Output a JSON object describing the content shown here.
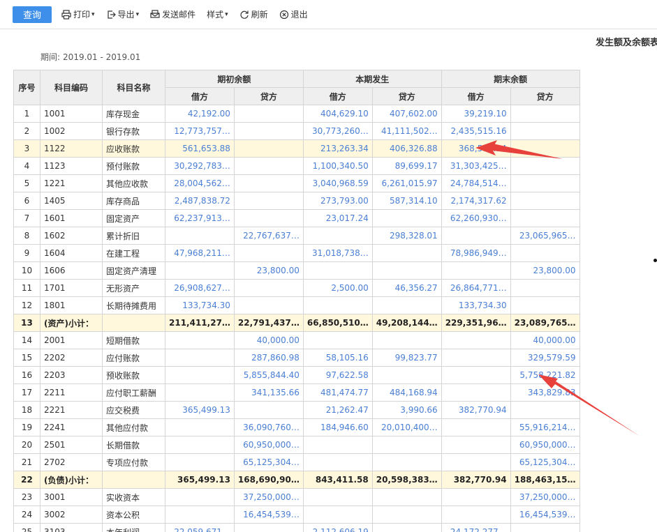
{
  "toolbar": {
    "query": "查询",
    "print": "打印",
    "export": "导出",
    "email": "发送邮件",
    "style": "样式",
    "refresh": "刷新",
    "exit": "退出"
  },
  "report": {
    "title": "发生额及余额表",
    "period_label": "期间:",
    "period_value": "2019.01 - 2019.01"
  },
  "table": {
    "headers": {
      "idx": "序号",
      "code": "科目编码",
      "name": "科目名称",
      "opening": "期初余额",
      "current": "本期发生",
      "closing": "期末余额",
      "debit": "借方",
      "credit": "贷方"
    },
    "rows": [
      {
        "idx": "1",
        "code": "1001",
        "name": "库存现金",
        "od": "42,192.00",
        "oc": "",
        "cd": "404,629.10",
        "cc": "407,602.00",
        "ed": "39,219.10",
        "ec": "",
        "type": ""
      },
      {
        "idx": "2",
        "code": "1002",
        "name": "银行存款",
        "od": "12,773,757…",
        "oc": "",
        "cd": "30,773,260…",
        "cc": "41,111,502…",
        "ed": "2,435,515.16",
        "ec": "",
        "type": ""
      },
      {
        "idx": "3",
        "code": "1122",
        "name": "应收账款",
        "od": "561,653.88",
        "oc": "",
        "cd": "213,263.34",
        "cc": "406,326.88",
        "ed": "368,590.34",
        "ec": "",
        "type": "hl"
      },
      {
        "idx": "4",
        "code": "1123",
        "name": "预付账款",
        "od": "30,292,783…",
        "oc": "",
        "cd": "1,100,340.50",
        "cc": "89,699.17",
        "ed": "31,303,425…",
        "ec": "",
        "type": ""
      },
      {
        "idx": "5",
        "code": "1221",
        "name": "其他应收款",
        "od": "28,004,562…",
        "oc": "",
        "cd": "3,040,968.59",
        "cc": "6,261,015.97",
        "ed": "24,784,514…",
        "ec": "",
        "type": ""
      },
      {
        "idx": "6",
        "code": "1405",
        "name": "库存商品",
        "od": "2,487,838.72",
        "oc": "",
        "cd": "273,793.00",
        "cc": "587,314.10",
        "ed": "2,174,317.62",
        "ec": "",
        "type": ""
      },
      {
        "idx": "7",
        "code": "1601",
        "name": "固定资产",
        "od": "62,237,913…",
        "oc": "",
        "cd": "23,017.24",
        "cc": "",
        "ed": "62,260,930…",
        "ec": "",
        "type": ""
      },
      {
        "idx": "8",
        "code": "1602",
        "name": "累计折旧",
        "od": "",
        "oc": "22,767,637…",
        "cd": "",
        "cc": "298,328.01",
        "ed": "",
        "ec": "23,065,965…",
        "type": ""
      },
      {
        "idx": "9",
        "code": "1604",
        "name": "在建工程",
        "od": "47,968,211…",
        "oc": "",
        "cd": "31,018,738…",
        "cc": "",
        "ed": "78,986,949…",
        "ec": "",
        "type": ""
      },
      {
        "idx": "10",
        "code": "1606",
        "name": "固定资产清理",
        "od": "",
        "oc": "23,800.00",
        "cd": "",
        "cc": "",
        "ed": "",
        "ec": "23,800.00",
        "type": ""
      },
      {
        "idx": "11",
        "code": "1701",
        "name": "无形资产",
        "od": "26,908,627…",
        "oc": "",
        "cd": "2,500.00",
        "cc": "46,356.27",
        "ed": "26,864,771…",
        "ec": "",
        "type": ""
      },
      {
        "idx": "12",
        "code": "1801",
        "name": "长期待摊费用",
        "od": "133,734.30",
        "oc": "",
        "cd": "",
        "cc": "",
        "ed": "133,734.30",
        "ec": "",
        "type": ""
      },
      {
        "idx": "13",
        "code": "(资产)小计：",
        "name": "",
        "od": "211,411,27…",
        "oc": "22,791,437…",
        "cd": "66,850,510…",
        "cc": "49,208,144…",
        "ed": "229,351,96…",
        "ec": "23,089,765…",
        "type": "sub"
      },
      {
        "idx": "14",
        "code": "2001",
        "name": "短期借款",
        "od": "",
        "oc": "40,000.00",
        "cd": "",
        "cc": "",
        "ed": "",
        "ec": "40,000.00",
        "type": ""
      },
      {
        "idx": "15",
        "code": "2202",
        "name": "应付账款",
        "od": "",
        "oc": "287,860.98",
        "cd": "58,105.16",
        "cc": "99,823.77",
        "ed": "",
        "ec": "329,579.59",
        "type": ""
      },
      {
        "idx": "16",
        "code": "2203",
        "name": "预收账款",
        "od": "",
        "oc": "5,855,844.40",
        "cd": "97,622.58",
        "cc": "",
        "ed": "",
        "ec": "5,758,221.82",
        "type": ""
      },
      {
        "idx": "17",
        "code": "2211",
        "name": "应付职工薪酬",
        "od": "",
        "oc": "341,135.66",
        "cd": "481,474.77",
        "cc": "484,168.94",
        "ed": "",
        "ec": "343,829.83",
        "type": ""
      },
      {
        "idx": "18",
        "code": "2221",
        "name": "应交税费",
        "od": "365,499.13",
        "oc": "",
        "cd": "21,262.47",
        "cc": "3,990.66",
        "ed": "382,770.94",
        "ec": "",
        "type": ""
      },
      {
        "idx": "19",
        "code": "2241",
        "name": "其他应付款",
        "od": "",
        "oc": "36,090,760…",
        "cd": "184,946.60",
        "cc": "20,010,400…",
        "ed": "",
        "ec": "55,916,214…",
        "type": ""
      },
      {
        "idx": "20",
        "code": "2501",
        "name": "长期借款",
        "od": "",
        "oc": "60,950,000…",
        "cd": "",
        "cc": "",
        "ed": "",
        "ec": "60,950,000…",
        "type": ""
      },
      {
        "idx": "21",
        "code": "2702",
        "name": "专项应付款",
        "od": "",
        "oc": "65,125,304…",
        "cd": "",
        "cc": "",
        "ed": "",
        "ec": "65,125,304…",
        "type": ""
      },
      {
        "idx": "22",
        "code": "(负债)小计：",
        "name": "",
        "od": "365,499.13",
        "oc": "168,690,90…",
        "cd": "843,411.58",
        "cc": "20,598,383…",
        "ed": "382,770.94",
        "ec": "188,463,15…",
        "type": "sub"
      },
      {
        "idx": "23",
        "code": "3001",
        "name": "实收资本",
        "od": "",
        "oc": "37,250,000…",
        "cd": "",
        "cc": "",
        "ed": "",
        "ec": "37,250,000…",
        "type": ""
      },
      {
        "idx": "24",
        "code": "3002",
        "name": "资本公积",
        "od": "",
        "oc": "16,454,539…",
        "cd": "",
        "cc": "",
        "ed": "",
        "ec": "16,454,539…",
        "type": ""
      },
      {
        "idx": "25",
        "code": "3103",
        "name": "本年利润",
        "od": "22,059,671…",
        "oc": "",
        "cd": "2,112,606.19",
        "cc": "",
        "ed": "24,172,277…",
        "ec": "",
        "type": ""
      }
    ]
  },
  "colors": {
    "accent": "#3d8fea",
    "number": "#4a7fd6",
    "highlight_row": "#fff8dc",
    "arrow": "#e8403a"
  }
}
